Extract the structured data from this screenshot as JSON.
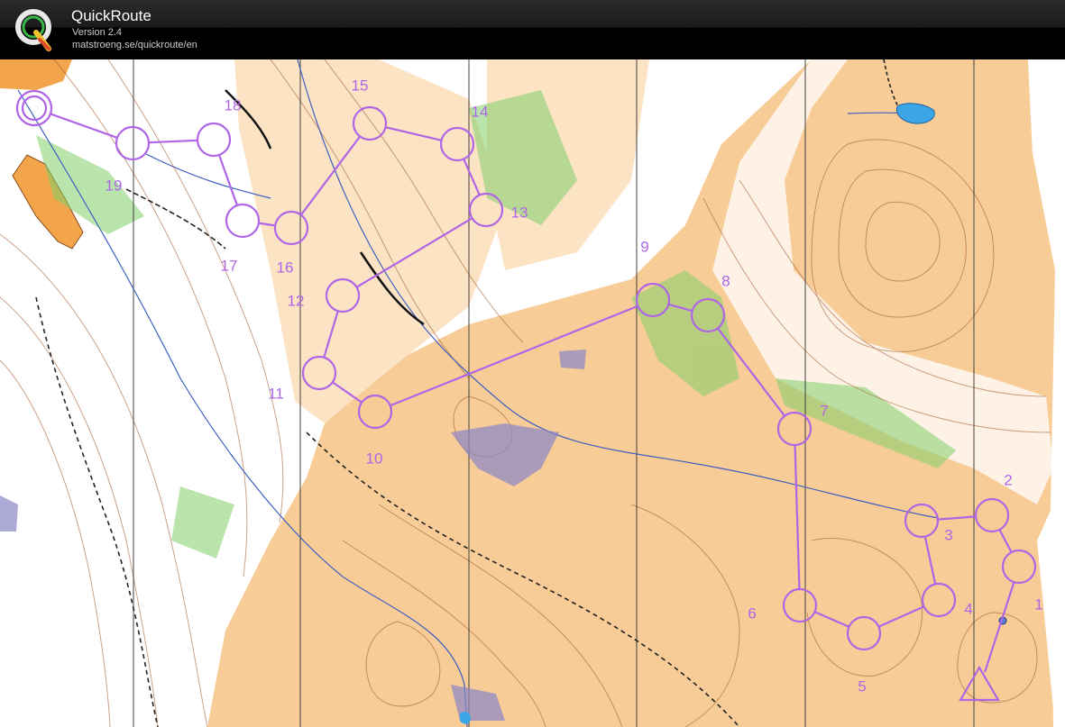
{
  "header": {
    "title": "QuickRoute",
    "version": "Version 2.4",
    "url": "matstroeng.se/quickroute/en"
  },
  "colors": {
    "course": "#b065e6",
    "open_land": "#f8cc96",
    "open_land_light": "#fbe3c4",
    "contour": "#a0562a",
    "vegetation_green": "#7fcf6a",
    "water": "#3aa6e6",
    "stream": "#3d5fc0",
    "marsh": "#8a86c8",
    "header_bg": "#000000"
  },
  "course": {
    "start_label": "",
    "controls": [
      {
        "number": "1"
      },
      {
        "number": "2"
      },
      {
        "number": "3"
      },
      {
        "number": "4"
      },
      {
        "number": "5"
      },
      {
        "number": "6"
      },
      {
        "number": "7"
      },
      {
        "number": "8"
      },
      {
        "number": "9"
      },
      {
        "number": "10"
      },
      {
        "number": "11"
      },
      {
        "number": "12"
      },
      {
        "number": "13"
      },
      {
        "number": "14"
      },
      {
        "number": "15"
      },
      {
        "number": "16"
      },
      {
        "number": "17"
      },
      {
        "number": "18"
      },
      {
        "number": "19"
      }
    ],
    "finish": {}
  }
}
